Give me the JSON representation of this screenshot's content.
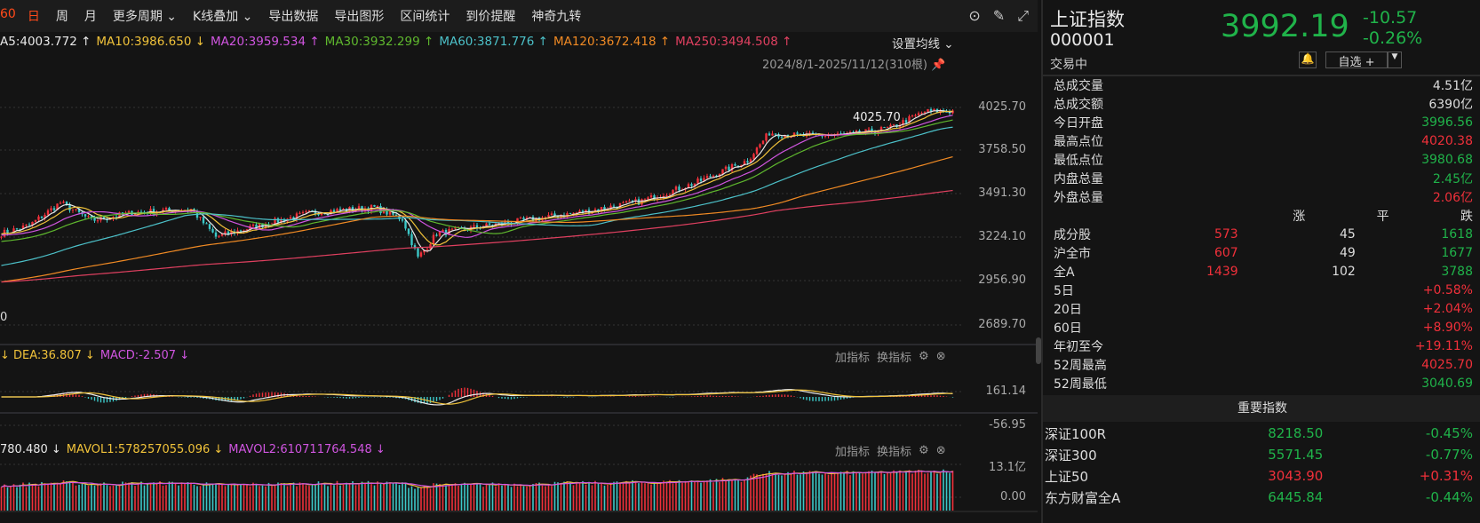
{
  "toolbar": {
    "items": [
      {
        "label": "60",
        "active": true
      },
      {
        "label": "日",
        "active": true
      },
      {
        "label": "周"
      },
      {
        "label": "月"
      },
      {
        "label": "更多周期 ⌄"
      },
      {
        "label": "K线叠加 ⌄"
      },
      {
        "label": "导出数据"
      },
      {
        "label": "导出图形"
      },
      {
        "label": "区间统计"
      },
      {
        "label": "到价提醒"
      },
      {
        "label": "神奇九转"
      }
    ],
    "icons": [
      "collapse-circle-icon",
      "brush-icon",
      "fullscreen-icon"
    ]
  },
  "ma_row": [
    {
      "text": "A5:4003.772 ↑",
      "color": "#e8e8e8"
    },
    {
      "text": "MA10:3986.650 ↓",
      "color": "#f0c23a"
    },
    {
      "text": "MA20:3959.534 ↑",
      "color": "#d055e0"
    },
    {
      "text": "MA30:3932.299 ↑",
      "color": "#5fb82e"
    },
    {
      "text": "MA60:3871.776 ↑",
      "color": "#4cc0c8"
    },
    {
      "text": "MA120:3672.418 ↑",
      "color": "#f08a24"
    },
    {
      "text": "MA250:3494.508 ↑",
      "color": "#e04060"
    }
  ],
  "set_ma": "设置均线 ⌄",
  "range_label": "2024/8/1-2025/11/12(310根)",
  "price_axis": [
    "4025.70",
    "3758.50",
    "3491.30",
    "3224.10",
    "2956.90",
    "2689.70"
  ],
  "left_cut_label": "0",
  "high_annotation": "4025.70",
  "macd": {
    "header": [
      {
        "text": "↓ DEA:36.807 ↓",
        "color": "#f0c23a"
      },
      {
        "text": "MACD:-2.507 ↓",
        "color": "#d055e0"
      }
    ],
    "axis": [
      "161.14",
      "-56.95"
    ]
  },
  "volume": {
    "header": [
      {
        "text": "780.480 ↓",
        "color": "#e8e8e8"
      },
      {
        "text": "MAVOL1:578257055.096 ↓",
        "color": "#f0c23a"
      },
      {
        "text": "MAVOL2:610711764.548 ↓",
        "color": "#d055e0"
      }
    ],
    "axis": [
      "13.1亿",
      "0.00"
    ]
  },
  "panel_tools": {
    "add": "加指标",
    "switch": "换指标"
  },
  "chart_data": {
    "type": "candlestick",
    "ylim": [
      2689.7,
      4160
    ],
    "up_color": "#f0303a",
    "down_color": "#3cc8c8",
    "anchors": [
      [
        0,
        3250
      ],
      [
        9,
        3300
      ],
      [
        19,
        3440
      ],
      [
        29,
        3330
      ],
      [
        43,
        3380
      ],
      [
        61,
        3400
      ],
      [
        69,
        3230
      ],
      [
        83,
        3300
      ],
      [
        100,
        3380
      ],
      [
        120,
        3410
      ],
      [
        129,
        3340
      ],
      [
        134,
        3100
      ],
      [
        140,
        3250
      ],
      [
        157,
        3300
      ],
      [
        186,
        3380
      ],
      [
        206,
        3450
      ],
      [
        223,
        3560
      ],
      [
        240,
        3700
      ],
      [
        247,
        3870
      ],
      [
        257,
        3850
      ],
      [
        274,
        3860
      ],
      [
        286,
        3900
      ],
      [
        297,
        4000
      ],
      [
        306,
        4003
      ]
    ]
  },
  "quote": {
    "name": "上证指数",
    "code": "000001",
    "status": "交易中",
    "price": "3992.19",
    "change": "-10.57",
    "pct": "-0.26%",
    "watch": "自选 +"
  },
  "stats": [
    {
      "l": "总成交量",
      "v": "4.51亿",
      "c": "w"
    },
    {
      "l": "总成交额",
      "v": "6390亿",
      "c": "w"
    },
    {
      "l": "今日开盘",
      "v": "3996.56",
      "c": "g"
    },
    {
      "l": "最高点位",
      "v": "4020.38",
      "c": "r"
    },
    {
      "l": "最低点位",
      "v": "3980.68",
      "c": "g"
    },
    {
      "l": "内盘总量",
      "v": "2.45亿",
      "c": "g"
    },
    {
      "l": "外盘总量",
      "v": "2.06亿",
      "c": "r"
    }
  ],
  "breadth_header": [
    "涨",
    "平",
    "跌"
  ],
  "breadth": [
    {
      "l": "成分股",
      "up": "573",
      "flat": "45",
      "down": "1618"
    },
    {
      "l": "沪全市",
      "up": "607",
      "flat": "49",
      "down": "1677"
    },
    {
      "l": "全A",
      "up": "1439",
      "flat": "102",
      "down": "3788"
    }
  ],
  "periods": [
    {
      "l": "5日",
      "v": "+0.58%",
      "c": "r"
    },
    {
      "l": "20日",
      "v": "+2.04%",
      "c": "r"
    },
    {
      "l": "60日",
      "v": "+8.90%",
      "c": "r"
    },
    {
      "l": "年初至今",
      "v": "+19.11%",
      "c": "r"
    },
    {
      "l": "52周最高",
      "v": "4025.70",
      "c": "r"
    },
    {
      "l": "52周最低",
      "v": "3040.69",
      "c": "g"
    }
  ],
  "index_title": "重要指数",
  "indices": [
    {
      "name": "深证100R",
      "price": "8218.50",
      "pct": "-0.45%",
      "c": "g"
    },
    {
      "name": "深证300",
      "price": "5571.45",
      "pct": "-0.77%",
      "c": "g"
    },
    {
      "name": "上证50",
      "price": "3043.90",
      "pct": "+0.31%",
      "c": "r"
    },
    {
      "name": "东方财富全A",
      "price": "6445.84",
      "pct": "-0.44%",
      "c": "g"
    }
  ]
}
